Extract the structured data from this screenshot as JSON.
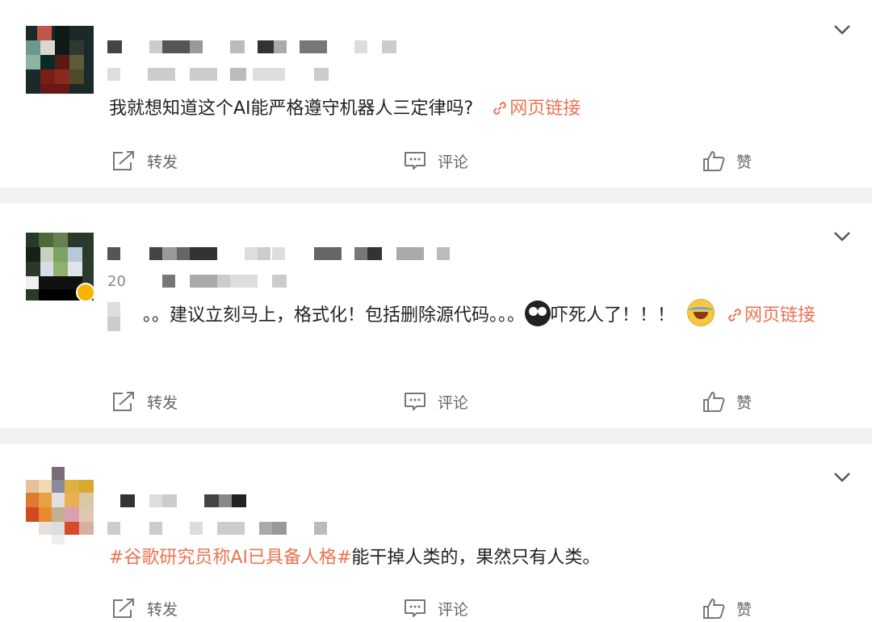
{
  "posts": [
    {
      "content": "我就想知道这个AI能严格遵守机器人三定律吗?",
      "link_text": "网页链接",
      "actions": {
        "repost": "转发",
        "comment": "评论",
        "like": "赞"
      }
    },
    {
      "meta_visible": "20",
      "content_a": "。。建议立刻马上，格式化！包括删除源代码。。。",
      "content_b": "吓死人了！！！",
      "link_text": "网页",
      "link_text_2": "链接",
      "actions": {
        "repost": "转发",
        "comment": "评论",
        "like": "赞"
      }
    },
    {
      "hashtag": "#谷歌研究员称AI已具备人格#",
      "content": "能干掉人类的，果然只有人类。",
      "actions": {
        "repost": "转发",
        "comment": "评论",
        "like": "赞"
      }
    }
  ],
  "icons": {
    "link": "link-icon",
    "chevron": "chevron-down-icon",
    "repost": "repost-icon",
    "comment": "comment-icon",
    "like": "thumbs-up-icon",
    "emoji_scared": "scared-emoji-icon",
    "emoji_laugh": "laugh-cry-emoji-icon"
  },
  "colors": {
    "link": "#eb7350",
    "action_text": "#666666",
    "separator": "#f2f2f2"
  }
}
